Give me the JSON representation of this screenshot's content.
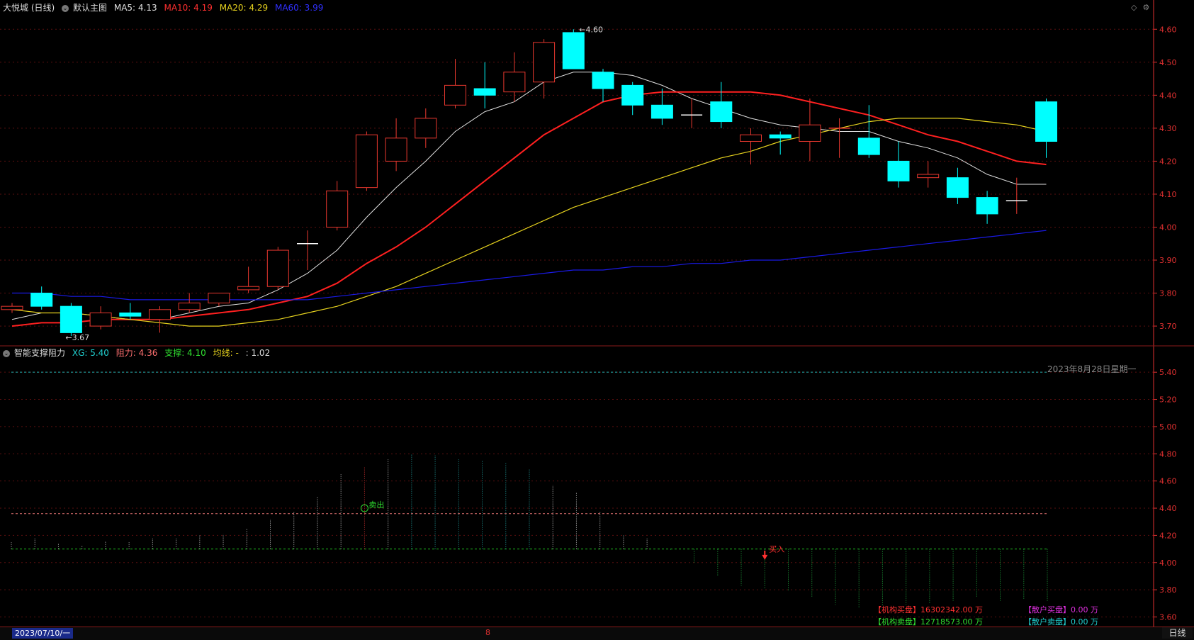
{
  "header": {
    "stock_name": "大悦城 (日线)",
    "main_chart_label": "默认主图",
    "ma5_label": "MA5: 4.13",
    "ma10_label": "MA10: 4.19",
    "ma20_label": "MA20: 4.29",
    "ma60_label": "MA60: 3.99"
  },
  "sub_header": {
    "indicator_name": "智能支撑阻力",
    "xg_label": "XG: 5.40",
    "resist_label": "阻力: 4.36",
    "support_label": "支撑: 4.10",
    "avg_label": "均线: -",
    "ratio_label": ": 1.02"
  },
  "colors": {
    "up": "#e8382f",
    "down": "#00ffff",
    "ma5": "#e0e0e0",
    "ma10": "#ff2020",
    "ma20": "#e6d21e",
    "ma60": "#1a1ae6",
    "grid": "#5a0f0f",
    "axis": "#e03030",
    "support_line": "#20c020",
    "resist_line": "#e07070",
    "xg_line": "#20b0b0"
  },
  "chart_data": [
    {
      "type": "candlestick",
      "y_ticks": [
        "4.60",
        "4.50",
        "4.40",
        "4.30",
        "4.20",
        "4.10",
        "4.00",
        "3.90",
        "3.80",
        "3.70"
      ],
      "ylim": [
        3.64,
        4.65
      ],
      "candles": [
        {
          "o": 3.75,
          "c": 3.76,
          "h": 3.77,
          "l": 3.74
        },
        {
          "o": 3.8,
          "c": 3.76,
          "h": 3.82,
          "l": 3.75
        },
        {
          "o": 3.76,
          "c": 3.68,
          "h": 3.77,
          "l": 3.67
        },
        {
          "o": 3.7,
          "c": 3.74,
          "h": 3.76,
          "l": 3.69
        },
        {
          "o": 3.74,
          "c": 3.73,
          "h": 3.77,
          "l": 3.72
        },
        {
          "o": 3.72,
          "c": 3.75,
          "h": 3.76,
          "l": 3.68
        },
        {
          "o": 3.75,
          "c": 3.77,
          "h": 3.8,
          "l": 3.74
        },
        {
          "o": 3.77,
          "c": 3.8,
          "h": 3.8,
          "l": 3.76
        },
        {
          "o": 3.81,
          "c": 3.82,
          "h": 3.88,
          "l": 3.8
        },
        {
          "o": 3.82,
          "c": 3.93,
          "h": 3.94,
          "l": 3.81
        },
        {
          "o": 3.95,
          "c": 3.95,
          "h": 3.99,
          "l": 3.87
        },
        {
          "o": 4.0,
          "c": 4.11,
          "h": 4.14,
          "l": 3.99
        },
        {
          "o": 4.12,
          "c": 4.28,
          "h": 4.29,
          "l": 4.11
        },
        {
          "o": 4.2,
          "c": 4.27,
          "h": 4.33,
          "l": 4.17
        },
        {
          "o": 4.27,
          "c": 4.33,
          "h": 4.36,
          "l": 4.24
        },
        {
          "o": 4.37,
          "c": 4.43,
          "h": 4.51,
          "l": 4.36
        },
        {
          "o": 4.42,
          "c": 4.4,
          "h": 4.5,
          "l": 4.36
        },
        {
          "o": 4.41,
          "c": 4.47,
          "h": 4.53,
          "l": 4.38
        },
        {
          "o": 4.44,
          "c": 4.56,
          "h": 4.57,
          "l": 4.39
        },
        {
          "o": 4.59,
          "c": 4.48,
          "h": 4.6,
          "l": 4.48
        },
        {
          "o": 4.47,
          "c": 4.42,
          "h": 4.48,
          "l": 4.38
        },
        {
          "o": 4.43,
          "c": 4.37,
          "h": 4.44,
          "l": 4.34
        },
        {
          "o": 4.37,
          "c": 4.33,
          "h": 4.42,
          "l": 4.31
        },
        {
          "o": 4.34,
          "c": 4.34,
          "h": 4.39,
          "l": 4.3
        },
        {
          "o": 4.38,
          "c": 4.32,
          "h": 4.44,
          "l": 4.3
        },
        {
          "o": 4.26,
          "c": 4.28,
          "h": 4.3,
          "l": 4.19
        },
        {
          "o": 4.28,
          "c": 4.27,
          "h": 4.29,
          "l": 4.22
        },
        {
          "o": 4.26,
          "c": 4.31,
          "h": 4.39,
          "l": 4.2
        },
        {
          "o": 4.3,
          "c": 4.3,
          "h": 4.33,
          "l": 4.21
        },
        {
          "o": 4.27,
          "c": 4.22,
          "h": 4.37,
          "l": 4.21
        },
        {
          "o": 4.2,
          "c": 4.14,
          "h": 4.26,
          "l": 4.12
        },
        {
          "o": 4.15,
          "c": 4.16,
          "h": 4.2,
          "l": 4.12
        },
        {
          "o": 4.15,
          "c": 4.09,
          "h": 4.18,
          "l": 4.07
        },
        {
          "o": 4.09,
          "c": 4.04,
          "h": 4.11,
          "l": 4.01
        },
        {
          "o": 4.08,
          "c": 4.08,
          "h": 4.15,
          "l": 4.04
        },
        {
          "o": 4.38,
          "c": 4.26,
          "h": 4.39,
          "l": 4.21
        }
      ],
      "series": [
        {
          "name": "MA5",
          "values": [
            3.72,
            3.74,
            3.74,
            3.73,
            3.72,
            3.72,
            3.74,
            3.76,
            3.77,
            3.81,
            3.86,
            3.93,
            4.03,
            4.12,
            4.2,
            4.29,
            4.35,
            4.38,
            4.44,
            4.47,
            4.47,
            4.46,
            4.43,
            4.39,
            4.36,
            4.33,
            4.31,
            4.3,
            4.29,
            4.29,
            4.26,
            4.24,
            4.21,
            4.16,
            4.13,
            4.13
          ]
        },
        {
          "name": "MA10",
          "values": [
            3.7,
            3.71,
            3.71,
            3.72,
            3.72,
            3.72,
            3.73,
            3.74,
            3.75,
            3.77,
            3.79,
            3.83,
            3.89,
            3.94,
            4.0,
            4.07,
            4.14,
            4.21,
            4.28,
            4.33,
            4.38,
            4.4,
            4.41,
            4.41,
            4.41,
            4.41,
            4.4,
            4.38,
            4.36,
            4.34,
            4.31,
            4.28,
            4.26,
            4.23,
            4.2,
            4.19
          ]
        },
        {
          "name": "MA20",
          "values": [
            3.75,
            3.74,
            3.74,
            3.73,
            3.72,
            3.71,
            3.7,
            3.7,
            3.71,
            3.72,
            3.74,
            3.76,
            3.79,
            3.82,
            3.86,
            3.9,
            3.94,
            3.98,
            4.02,
            4.06,
            4.09,
            4.12,
            4.15,
            4.18,
            4.21,
            4.23,
            4.26,
            4.28,
            4.3,
            4.32,
            4.33,
            4.33,
            4.33,
            4.32,
            4.31,
            4.29
          ]
        },
        {
          "name": "MA60",
          "values": [
            3.8,
            3.8,
            3.79,
            3.79,
            3.78,
            3.78,
            3.78,
            3.78,
            3.78,
            3.78,
            3.78,
            3.79,
            3.8,
            3.81,
            3.82,
            3.83,
            3.84,
            3.85,
            3.86,
            3.87,
            3.87,
            3.88,
            3.88,
            3.89,
            3.89,
            3.9,
            3.9,
            3.91,
            3.92,
            3.93,
            3.94,
            3.95,
            3.96,
            3.97,
            3.98,
            3.99
          ]
        }
      ],
      "annotations": {
        "high_label": "4.60",
        "low_label": "3.67"
      }
    },
    {
      "type": "indicator",
      "y_ticks": [
        "5.40",
        "5.20",
        "5.00",
        "4.80",
        "4.60",
        "4.40",
        "4.20",
        "4.00",
        "3.80",
        "3.60"
      ],
      "ylim": [
        3.54,
        5.5
      ],
      "levels": {
        "xg": 5.4,
        "resist": 4.36,
        "support": 4.1
      },
      "bar_tops": [
        4.15,
        4.18,
        4.14,
        4.13,
        4.16,
        4.15,
        4.18,
        4.18,
        4.2,
        4.21,
        4.25,
        4.32,
        4.37,
        4.49,
        4.65,
        4.7,
        4.76,
        4.8,
        4.79,
        4.76,
        4.75,
        4.73,
        4.69,
        4.57,
        4.52,
        4.37,
        4.2,
        4.18,
        4.09,
        3.99,
        3.9,
        3.83,
        3.81,
        3.79,
        3.74,
        3.69,
        3.67,
        3.68,
        3.69,
        3.7,
        3.72,
        3.74,
        3.72,
        3.73,
        3.71
      ],
      "sell_signal_label": "卖出",
      "buy_signal_label": "买入",
      "date_label": "2023年8月28日星期一"
    }
  ],
  "capital_flow": {
    "inst_buy": "【机构买盘】16302342.00 万",
    "inst_sell": "【机构卖盘】12718573.00 万",
    "retail_buy": "【散户买盘】0.00 万",
    "retail_sell": "【散户卖盘】0.00 万"
  },
  "footer": {
    "date": "2023/07/10/一",
    "month_marker": "8",
    "timeframe": "日线"
  }
}
